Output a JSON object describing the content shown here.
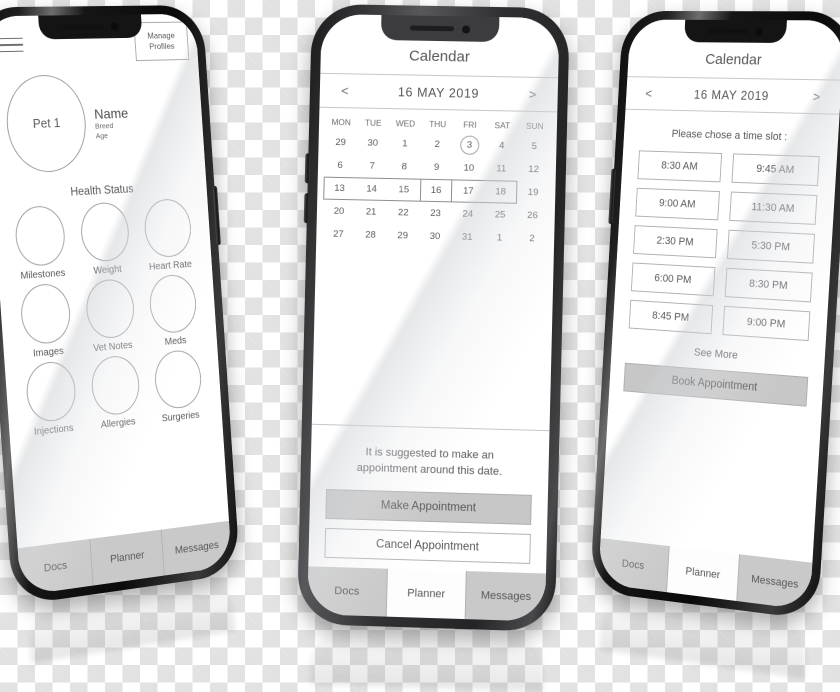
{
  "phone1": {
    "menu_icon": "hamburger-icon",
    "manage_button": {
      "line1": "Manage",
      "line2": "Profiles"
    },
    "profile": {
      "avatar_label": "Pet 1",
      "name": "Name",
      "breed": "Breed",
      "age": "Age"
    },
    "section_title": "Health Status",
    "tiles": [
      "Milestones",
      "Weight",
      "Heart Rate",
      "Images",
      "Vet Notes",
      "Meds",
      "Injections",
      "Allergies",
      "Surgeries"
    ],
    "tabs": [
      {
        "label": "Docs",
        "active": false
      },
      {
        "label": "Planner",
        "active": false
      },
      {
        "label": "Messages",
        "active": false
      }
    ]
  },
  "phone2": {
    "title": "Calendar",
    "month": {
      "prev_arrow": "<",
      "label": "16 MAY 2019",
      "next_arrow": ">"
    },
    "day_headers": [
      "MON",
      "TUE",
      "WED",
      "THU",
      "FRI",
      "SAT",
      "SUN"
    ],
    "weeks": [
      [
        "29",
        "30",
        "1",
        "2",
        "3",
        "4",
        "5"
      ],
      [
        "6",
        "7",
        "8",
        "9",
        "10",
        "11",
        "12"
      ],
      [
        "13",
        "14",
        "15",
        "16",
        "17",
        "18",
        "19"
      ],
      [
        "20",
        "21",
        "22",
        "23",
        "24",
        "25",
        "26"
      ],
      [
        "27",
        "28",
        "29",
        "30",
        "31",
        "1",
        "2"
      ]
    ],
    "today_index": {
      "week": 0,
      "day": 4
    },
    "range": {
      "week": 2,
      "start": 0,
      "selected": 3,
      "end": 5
    },
    "suggestion": "It is suggested to make an appointment around this date.",
    "make_button": "Make Appointment",
    "cancel_button": "Cancel Appointment",
    "tabs": [
      {
        "label": "Docs",
        "active": false
      },
      {
        "label": "Planner",
        "active": true
      },
      {
        "label": "Messages",
        "active": false
      }
    ]
  },
  "phone3": {
    "title": "Calendar",
    "month": {
      "prev_arrow": "<",
      "label": "16 MAY 2019",
      "next_arrow": ">"
    },
    "prompt": "Please chose a time slot :",
    "slots": [
      "8:30 AM",
      "9:45 AM",
      "9:00 AM",
      "11:30 AM",
      "2:30 PM",
      "5:30 PM",
      "6:00 PM",
      "8:30 PM",
      "8:45 PM",
      "9:00 PM"
    ],
    "see_more": "See More",
    "book_button": "Book Appointment",
    "tabs": [
      {
        "label": "Docs",
        "active": false
      },
      {
        "label": "Planner",
        "active": true
      },
      {
        "label": "Messages",
        "active": false
      }
    ]
  },
  "colors": {
    "frame_dark": "#0d0d0d",
    "frame_gray": "#3c3c3e",
    "screen_bg": "#ffffff",
    "line": "#a5a5a9",
    "text": "#58585b",
    "tab_inactive": "#c9c9c9",
    "button_filled": "#c7c7c7"
  }
}
